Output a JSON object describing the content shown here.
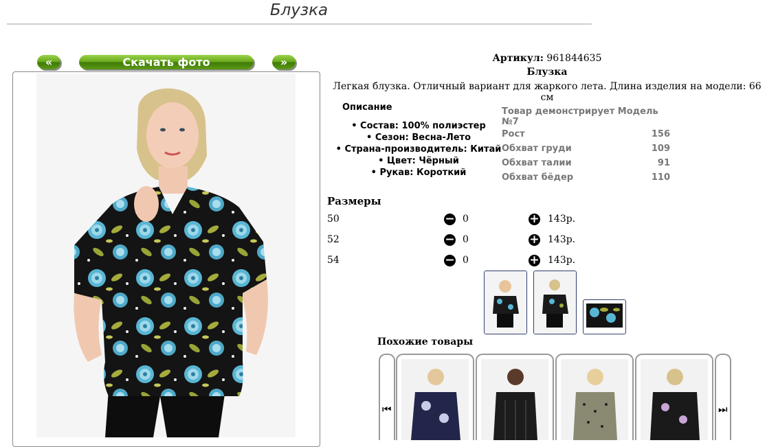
{
  "header": {
    "title": "Блузка"
  },
  "gallery": {
    "prev_label": "«",
    "next_label": "»",
    "download_label": "Скачать фото"
  },
  "product": {
    "article_label": "Артикул:",
    "article_value": "961844635",
    "name": "Блузка",
    "summary": "Легкая блузка. Отличный вариант для жаркого лета. Длина изделия на модели: 66 см"
  },
  "description": {
    "title": "Описание",
    "items": [
      "Состав: 100% полиэстер",
      "Сезон: Весна-Лето",
      "Страна-производитель: Китай",
      "Цвет: Чёрный",
      "Рукав: Короткий"
    ]
  },
  "model": {
    "title": "Товар демонстрирует Модель №7",
    "rows": [
      {
        "label": "Рост",
        "value": "156"
      },
      {
        "label": "Обхват груди",
        "value": "109"
      },
      {
        "label": "Обхват талии",
        "value": "91"
      },
      {
        "label": "Обхват бёдер",
        "value": "110"
      }
    ]
  },
  "sizes": {
    "title": "Размеры",
    "rows": [
      {
        "size": "50",
        "qty": "0",
        "price": "143р."
      },
      {
        "size": "52",
        "qty": "0",
        "price": "143р."
      },
      {
        "size": "54",
        "qty": "0",
        "price": "143р."
      }
    ]
  },
  "similar": {
    "title": "Похожие товары"
  },
  "colors": {
    "button_green": "#68a81c",
    "blouse_black": "#111111",
    "flower_blue": "#58b6d4",
    "leaf_olive": "#a3ac3c",
    "thumb_border": "#2f3f6f"
  },
  "icons": {
    "minus": "minus-circle-icon",
    "plus": "plus-circle-icon",
    "first": "skip-back-icon",
    "last": "skip-forward-icon"
  }
}
